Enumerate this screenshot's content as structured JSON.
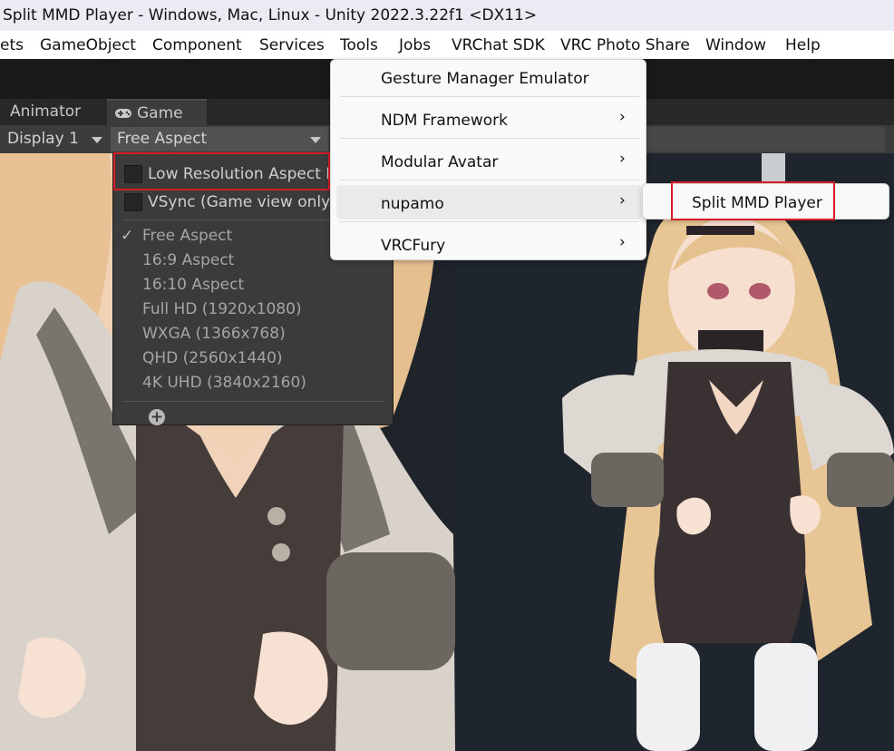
{
  "window": {
    "title": "Split MMD Player - Windows, Mac, Linux - Unity 2022.3.22f1 <DX11>"
  },
  "menubar": {
    "items": [
      "ets",
      "GameObject",
      "Component",
      "Services",
      "Tools",
      "Jobs",
      "VRChat SDK",
      "VRC Photo Share",
      "Window",
      "Help"
    ]
  },
  "tabs": {
    "animator": "Animator",
    "game": "Game"
  },
  "gamebar": {
    "display": "Display 1",
    "aspect": "Free Aspect"
  },
  "aspect_menu": {
    "low_resolution": "Low Resolution Aspect Ratios",
    "vsync": "VSync (Game view only)",
    "options": [
      "Free Aspect",
      "16:9 Aspect",
      "16:10 Aspect",
      "Full HD (1920x1080)",
      "WXGA (1366x768)",
      "QHD (2560x1440)",
      "4K UHD (3840x2160)"
    ],
    "checkmark": "✓",
    "add_symbol": "+"
  },
  "tools_menu": {
    "items": [
      "Gesture Manager Emulator",
      "NDM Framework",
      "Modular Avatar",
      "nupamo",
      "VRCFury"
    ],
    "chevron": "›"
  },
  "submenu": {
    "item": "Split MMD Player"
  },
  "colors": {
    "highlight": "#d41d25"
  },
  "icons": {
    "game_tab": "gamepad-icon",
    "add": "plus-circle-icon",
    "check": "checkmark-icon"
  }
}
